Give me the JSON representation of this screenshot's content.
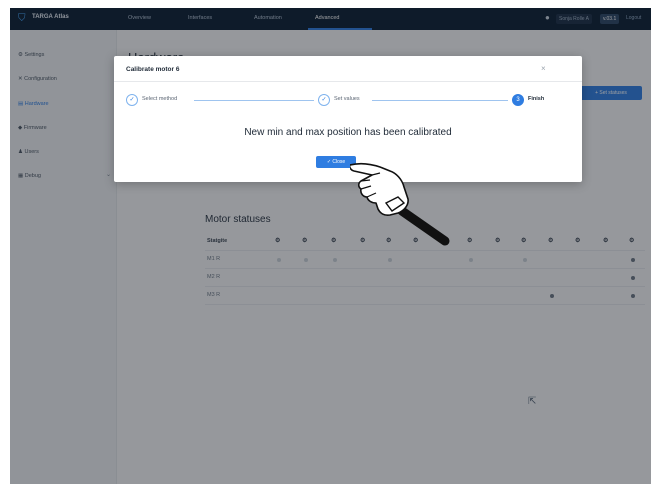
{
  "topbar": {
    "brand": "TARGA Atlas",
    "tabs": [
      "Overview",
      "Interfaces",
      "Automation",
      "Advanced"
    ],
    "active_tab": "Advanced",
    "user": "Sonja Rolle A",
    "version": "v.03.1",
    "logout": "Logout"
  },
  "sidebar": {
    "items": [
      "Settings",
      "Configuration",
      "Hardware",
      "Firmware",
      "Users",
      "Debug"
    ],
    "active_item": "Hardware"
  },
  "page": {
    "title": "Hardware",
    "action_button": "+ Set statuses",
    "section_title": "Motor statuses",
    "table_header": "Statgite",
    "rows": [
      "M1 R",
      "M2 R",
      "M3 R"
    ]
  },
  "modal": {
    "title": "Calibrate motor 6",
    "close_symbol": "×",
    "steps": [
      {
        "label": "Select method",
        "symbol": "✓"
      },
      {
        "label": "Set values",
        "symbol": "✓"
      },
      {
        "label": "Finish",
        "symbol": "3"
      }
    ],
    "message": "New min and max position has been calibrated",
    "button_label": "✓ Close"
  },
  "colors": {
    "accent": "#2f7de1",
    "topbar": "#0b1e33"
  }
}
